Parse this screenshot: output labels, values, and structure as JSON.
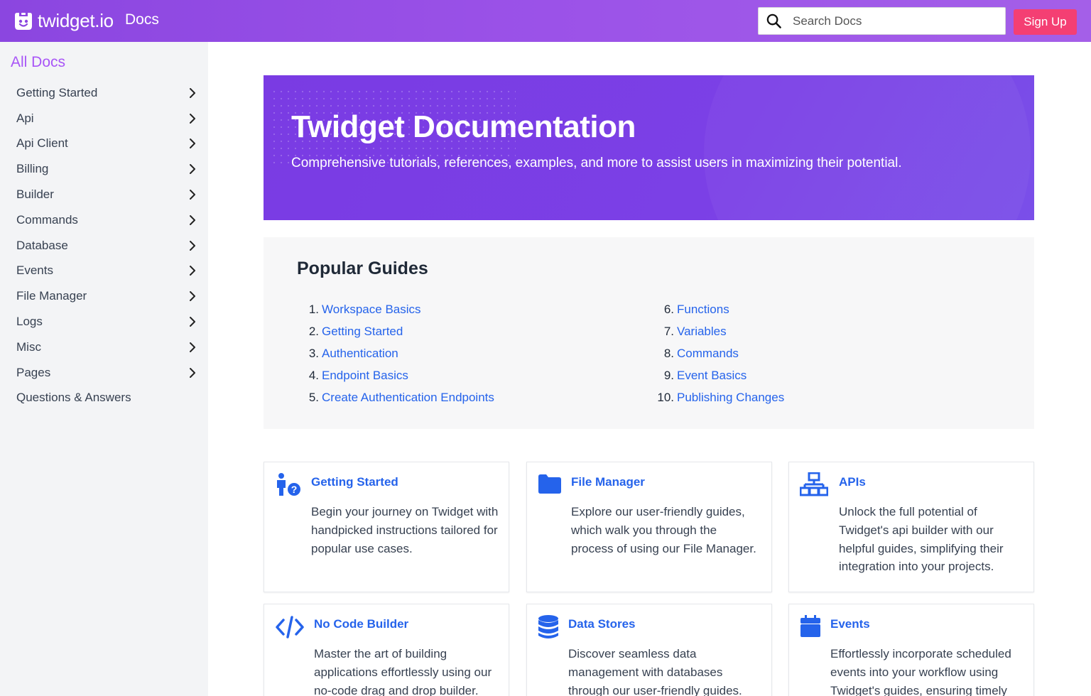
{
  "header": {
    "logo_text": "twidget.io",
    "docs_label": "Docs",
    "search_placeholder": "Search Docs",
    "signup_label": "Sign Up"
  },
  "sidebar": {
    "title": "All Docs",
    "items": [
      {
        "label": "Getting Started",
        "expandable": true
      },
      {
        "label": "Api",
        "expandable": true
      },
      {
        "label": "Api Client",
        "expandable": true
      },
      {
        "label": "Billing",
        "expandable": true
      },
      {
        "label": "Builder",
        "expandable": true
      },
      {
        "label": "Commands",
        "expandable": true
      },
      {
        "label": "Database",
        "expandable": true
      },
      {
        "label": "Events",
        "expandable": true
      },
      {
        "label": "File Manager",
        "expandable": true
      },
      {
        "label": "Logs",
        "expandable": true
      },
      {
        "label": "Misc",
        "expandable": true
      },
      {
        "label": "Pages",
        "expandable": true
      },
      {
        "label": "Questions & Answers",
        "expandable": false
      }
    ]
  },
  "hero": {
    "title": "Twidget Documentation",
    "subtitle": "Comprehensive tutorials, references, examples, and more to assist users in maximizing their potential."
  },
  "popular_guides": {
    "title": "Popular Guides",
    "items": [
      {
        "num": "1.",
        "label": "Workspace Basics"
      },
      {
        "num": "2.",
        "label": "Getting Started"
      },
      {
        "num": "3.",
        "label": "Authentication"
      },
      {
        "num": "4.",
        "label": "Endpoint Basics"
      },
      {
        "num": "5.",
        "label": "Create Authentication Endpoints"
      },
      {
        "num": "6.",
        "label": "Functions"
      },
      {
        "num": "7.",
        "label": "Variables"
      },
      {
        "num": "8.",
        "label": "Commands"
      },
      {
        "num": "9.",
        "label": "Event Basics"
      },
      {
        "num": "10.",
        "label": "Publishing Changes"
      }
    ]
  },
  "cards": [
    {
      "title": "Getting Started",
      "icon": "person-question-icon",
      "body": "Begin your journey on Twidget with handpicked instructions tailored for popular use cases."
    },
    {
      "title": "File Manager",
      "icon": "folder-icon",
      "body": "Explore our user-friendly guides, which walk you through the process of using our File Manager."
    },
    {
      "title": "APIs",
      "icon": "network-icon",
      "body": "Unlock the full potential of Twidget's api builder with our helpful guides, simplifying their integration into your projects."
    },
    {
      "title": "No Code Builder",
      "icon": "code-icon",
      "body": "Master the art of building applications effortlessly using our no-code drag and drop builder."
    },
    {
      "title": "Data Stores",
      "icon": "database-icon",
      "body": "Discover seamless data management with databases through our user-friendly guides."
    },
    {
      "title": "Events",
      "icon": "calendar-icon",
      "body": "Effortlessly incorporate scheduled events into your workflow using Twidget's guides, ensuring timely"
    }
  ],
  "colors": {
    "header_gradient": [
      "#8b46e0",
      "#a45fe8"
    ],
    "accent_purple": "#a855f7",
    "hero_purple": "#7a3be3",
    "link_blue": "#2563eb",
    "signup_pink": "#f43f73"
  }
}
